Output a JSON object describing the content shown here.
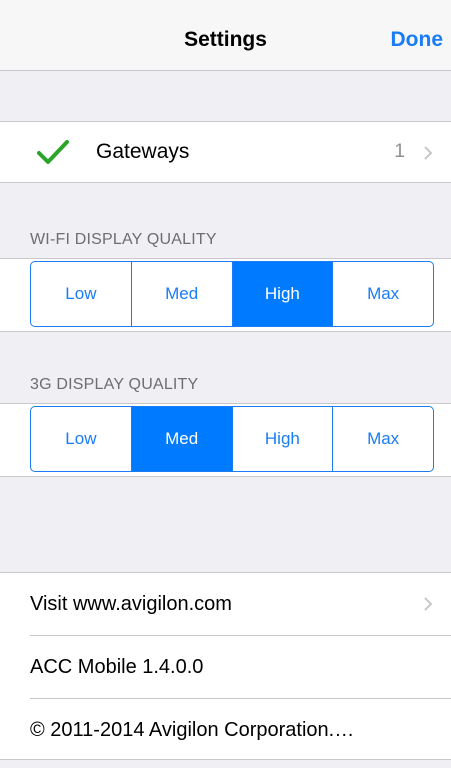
{
  "navbar": {
    "title": "Settings",
    "done_label": "Done"
  },
  "gateways": {
    "label": "Gateways",
    "count": "1",
    "checked": true,
    "check_color": "#2aa52a"
  },
  "wifi_quality": {
    "header": "WI-FI DISPLAY QUALITY",
    "options": [
      "Low",
      "Med",
      "High",
      "Max"
    ],
    "selected": "High"
  },
  "cellular_quality": {
    "header": "3G DISPLAY QUALITY",
    "options": [
      "Low",
      "Med",
      "High",
      "Max"
    ],
    "selected": "Med"
  },
  "info": {
    "website_label": "Visit www.avigilon.com",
    "version_label": "ACC Mobile 1.4.0.0",
    "copyright_label": "© 2011-2014 Avigilon Corporation.…"
  },
  "colors": {
    "accent": "#007aff",
    "background": "#efeff4",
    "separator": "#c8c7cc",
    "secondary_text": "#8e8e93"
  }
}
